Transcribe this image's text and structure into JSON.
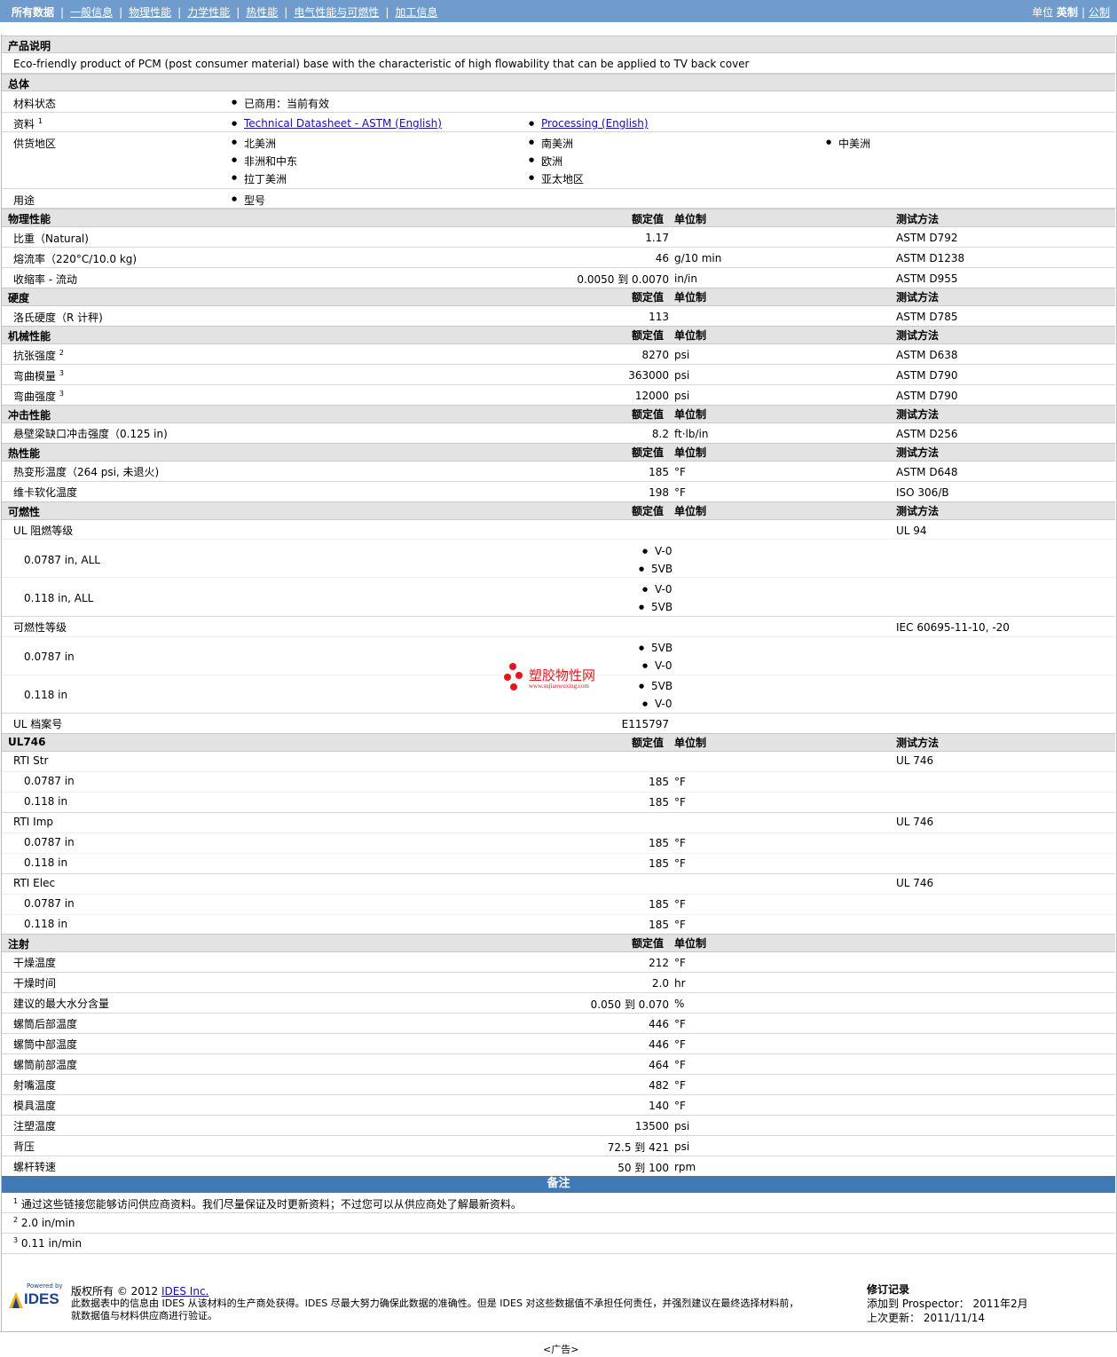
{
  "tabs": [
    "所有数据",
    "一般信息",
    "物理性能",
    "力学性能",
    "热性能",
    "电气性能与可燃性",
    "加工信息"
  ],
  "units_bar": {
    "label": "单位",
    "imperial": "英制",
    "metric": "公制"
  },
  "headers": {
    "value": "额定值",
    "unit": "单位制",
    "method": "测试方法"
  },
  "description": {
    "title": "产品说明",
    "text": "Eco-friendly product of PCM (post consumer material) base with the characteristic of high flowability that can be applied to TV back cover"
  },
  "general": {
    "title": "总体",
    "status_label": "材料状态",
    "status_value": "已商用：当前有效",
    "docs_label": "资料",
    "docs_sup": "1",
    "doc1": "Technical Datasheet - ASTM (English)",
    "doc2": "Processing (English)",
    "supply_label": "供货地区",
    "regions": [
      "北美洲",
      "南美洲",
      "中美洲",
      "非洲和中东",
      "欧洲",
      "拉丁美洲",
      "亚太地区"
    ],
    "use_label": "用途",
    "use_value": "型号"
  },
  "physical": {
    "title": "物理性能",
    "rows": [
      {
        "label": "比重（Natural)",
        "value": "1.17",
        "unit": "",
        "method": "ASTM D792"
      },
      {
        "label": "熔流率（220°C/10.0 kg)",
        "value": "46",
        "unit": "g/10 min",
        "method": "ASTM D1238"
      },
      {
        "label": "收缩率 - 流动",
        "value": "0.0050 到  0.0070",
        "unit": "in/in",
        "method": "ASTM D955"
      }
    ]
  },
  "hardness": {
    "title": "硬度",
    "rows": [
      {
        "label": "洛氏硬度（R 计秤)",
        "value": "113",
        "unit": "",
        "method": "ASTM D785"
      }
    ]
  },
  "mechanical": {
    "title": "机械性能",
    "rows": [
      {
        "label": "抗张强度",
        "sup": "2",
        "value": "8270",
        "unit": "psi",
        "method": "ASTM D638"
      },
      {
        "label": "弯曲模量",
        "sup": "3",
        "value": "363000",
        "unit": "psi",
        "method": "ASTM D790"
      },
      {
        "label": "弯曲强度",
        "sup": "3",
        "value": "12000",
        "unit": "psi",
        "method": "ASTM D790"
      }
    ]
  },
  "impact": {
    "title": "冲击性能",
    "rows": [
      {
        "label": "悬壁梁缺口冲击强度（0.125 in)",
        "value": "8.2",
        "unit": "ft·lb/in",
        "method": "ASTM D256"
      }
    ]
  },
  "thermal": {
    "title": "热性能",
    "rows": [
      {
        "label": "热变形温度（264 psi, 未退火)",
        "value": "185",
        "unit": "°F",
        "method": "ASTM D648"
      },
      {
        "label": "维卡软化温度",
        "value": "198",
        "unit": "°F",
        "method": "ISO 306/B"
      }
    ]
  },
  "flammability": {
    "title": "可燃性",
    "ul_label": "UL 阻燃等级",
    "ul_method": "UL 94",
    "ul_a_label": "0.0787 in, ALL",
    "ul_a_vals": [
      "V-0",
      "5VB"
    ],
    "ul_b_label": "0.118 in, ALL",
    "ul_b_vals": [
      "V-0",
      "5VB"
    ],
    "iec_label": "可燃性等级",
    "iec_method": "IEC 60695-11-10, -20",
    "iec_a_label": "0.0787 in",
    "iec_a_vals": [
      "5VB",
      "V-0"
    ],
    "iec_b_label": "0.118 in",
    "iec_b_vals": [
      "5VB",
      "V-0"
    ],
    "file_label": "UL 档案号",
    "file_value": "E115797"
  },
  "watermark": {
    "name": "塑胶物性网",
    "url": "www.sujiaowuxing.com"
  },
  "ul746": {
    "title": "UL746",
    "groups": [
      {
        "label": "RTI Str",
        "method": "UL 746",
        "rows": [
          {
            "label": "0.0787 in",
            "value": "185",
            "unit": "°F"
          },
          {
            "label": "0.118 in",
            "value": "185",
            "unit": "°F"
          }
        ]
      },
      {
        "label": "RTI Imp",
        "method": "UL 746",
        "rows": [
          {
            "label": "0.0787 in",
            "value": "185",
            "unit": "°F"
          },
          {
            "label": "0.118 in",
            "value": "185",
            "unit": "°F"
          }
        ]
      },
      {
        "label": "RTI Elec",
        "method": "UL 746",
        "rows": [
          {
            "label": "0.0787 in",
            "value": "185",
            "unit": "°F"
          },
          {
            "label": "0.118 in",
            "value": "185",
            "unit": "°F"
          }
        ]
      }
    ]
  },
  "injection": {
    "title": "注射",
    "rows": [
      {
        "label": "干燥温度",
        "value": "212",
        "unit": "°F"
      },
      {
        "label": "干燥时间",
        "value": "2.0",
        "unit": "hr"
      },
      {
        "label": "建议的最大水分含量",
        "value": "0.050 到  0.070",
        "unit": "%"
      },
      {
        "label": "螺筒后部温度",
        "value": "446",
        "unit": "°F"
      },
      {
        "label": "螺筒中部温度",
        "value": "446",
        "unit": "°F"
      },
      {
        "label": "螺筒前部温度",
        "value": "464",
        "unit": "°F"
      },
      {
        "label": "射嘴温度",
        "value": "482",
        "unit": "°F"
      },
      {
        "label": "模具温度",
        "value": "140",
        "unit": "°F"
      },
      {
        "label": "注塑温度",
        "value": "13500",
        "unit": "psi"
      },
      {
        "label": "背压",
        "value": "72.5 到  421",
        "unit": "psi"
      },
      {
        "label": "螺杆转速",
        "value": "50 到  100",
        "unit": "rpm"
      }
    ]
  },
  "notes": {
    "title": "备注",
    "items": [
      {
        "num": "1",
        "text": "通过这些链接您能够访问供应商资料。我们尽量保证及时更新资料；不过您可以从供应商处了解最新资料。"
      },
      {
        "num": "2",
        "text": "2.0 in/min"
      },
      {
        "num": "3",
        "text": "0.11 in/min"
      }
    ]
  },
  "footer": {
    "powered": "Powered by",
    "logo": "IDES",
    "copyright": "版权所有  © 2012",
    "company": "IDES Inc.",
    "disclaimer1": "此数据表中的信息由  IDES 从该材料的生产商处获得。IDES 尽最大努力确保此数据的准确性。但是  IDES 对这些数据值不承担任何责任，并强烈建议在最终选择材料前，",
    "disclaimer2": "就数据值与材料供应商进行验证。",
    "rev_title": "修订记录",
    "added": "添加到  Prospector：  2011年2月",
    "updated": "上次更新：  2011/11/14"
  },
  "ad": "<广告>"
}
